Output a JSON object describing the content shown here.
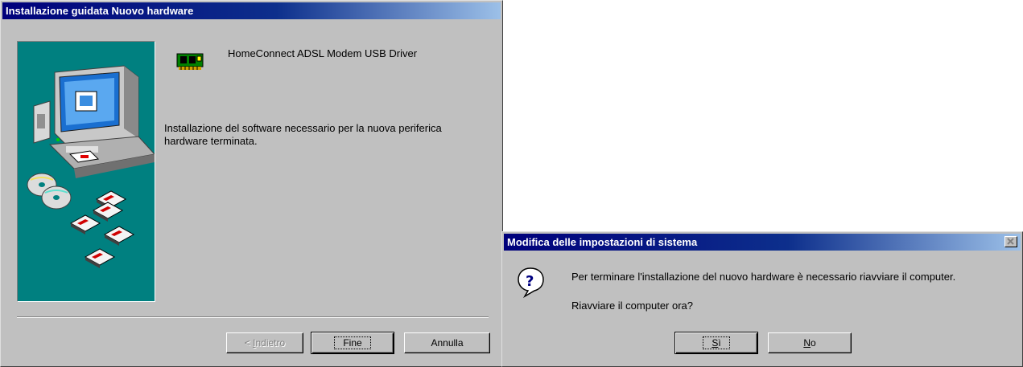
{
  "wizard": {
    "title": "Installazione guidata Nuovo hardware",
    "device_name": "HomeConnect ADSL Modem USB Driver",
    "message": "Installazione del software necessario per la nuova periferica hardware terminata.",
    "buttons": {
      "back": {
        "pre": "< ",
        "mnemonic": "I",
        "rest": "ndietro"
      },
      "finish": "Fine",
      "cancel": "Annulla"
    }
  },
  "dialog": {
    "title": "Modifica delle impostazioni di sistema",
    "message": "Per terminare l'installazione del nuovo hardware è necessario riavviare il computer.",
    "question": "Riavviare il computer ora?",
    "buttons": {
      "yes": {
        "mnemonic": "S",
        "rest": "ì"
      },
      "no": {
        "mnemonic": "N",
        "rest": "o"
      }
    }
  },
  "colors": {
    "title_bar_start": "#00007b",
    "title_bar_end": "#9cc0e8",
    "panel_teal": "#008080",
    "window_gray": "#c0c0c0"
  }
}
